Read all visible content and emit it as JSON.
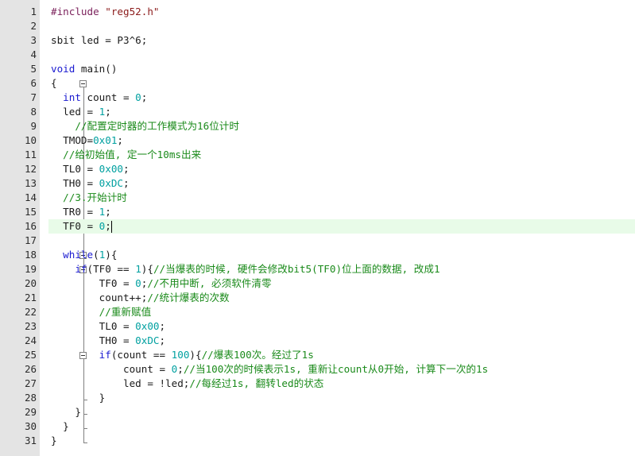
{
  "editor": {
    "line_numbers": [
      "1",
      "2",
      "3",
      "4",
      "5",
      "6",
      "7",
      "8",
      "9",
      "10",
      "11",
      "12",
      "13",
      "14",
      "15",
      "16",
      "17",
      "18",
      "19",
      "20",
      "21",
      "22",
      "23",
      "24",
      "25",
      "26",
      "27",
      "28",
      "29",
      "30",
      "31"
    ],
    "lines": [
      {
        "tokens": [
          {
            "t": "pp",
            "v": "#include "
          },
          {
            "t": "str",
            "v": "\"reg52.h\""
          }
        ]
      },
      {
        "tokens": []
      },
      {
        "tokens": [
          {
            "t": "tx",
            "v": "sbit led = P3^6;"
          }
        ]
      },
      {
        "tokens": []
      },
      {
        "tokens": [
          {
            "t": "kw",
            "v": "void"
          },
          {
            "t": "tx",
            "v": " main()"
          }
        ]
      },
      {
        "tokens": [
          {
            "t": "tx",
            "v": "{"
          }
        ]
      },
      {
        "tokens": [
          {
            "t": "tx",
            "v": "  "
          },
          {
            "t": "kw",
            "v": "int"
          },
          {
            "t": "tx",
            "v": " count = "
          },
          {
            "t": "num",
            "v": "0"
          },
          {
            "t": "tx",
            "v": ";"
          }
        ]
      },
      {
        "tokens": [
          {
            "t": "tx",
            "v": "  led = "
          },
          {
            "t": "num",
            "v": "1"
          },
          {
            "t": "tx",
            "v": ";"
          }
        ]
      },
      {
        "tokens": [
          {
            "t": "tx",
            "v": "    "
          },
          {
            "t": "cm",
            "v": "//配置定时器的工作模式为16位计时"
          }
        ]
      },
      {
        "tokens": [
          {
            "t": "tx",
            "v": "  TMOD="
          },
          {
            "t": "num",
            "v": "0x01"
          },
          {
            "t": "tx",
            "v": ";"
          }
        ]
      },
      {
        "tokens": [
          {
            "t": "tx",
            "v": "  "
          },
          {
            "t": "cm",
            "v": "//给初始值, 定一个10ms出来"
          }
        ]
      },
      {
        "tokens": [
          {
            "t": "tx",
            "v": "  TL0 = "
          },
          {
            "t": "num",
            "v": "0x00"
          },
          {
            "t": "tx",
            "v": ";"
          }
        ]
      },
      {
        "tokens": [
          {
            "t": "tx",
            "v": "  TH0 = "
          },
          {
            "t": "num",
            "v": "0xDC"
          },
          {
            "t": "tx",
            "v": ";"
          }
        ]
      },
      {
        "tokens": [
          {
            "t": "tx",
            "v": "  "
          },
          {
            "t": "cm",
            "v": "//3.开始计时"
          }
        ]
      },
      {
        "tokens": [
          {
            "t": "tx",
            "v": "  TR0 = "
          },
          {
            "t": "num",
            "v": "1"
          },
          {
            "t": "tx",
            "v": ";"
          }
        ]
      },
      {
        "tokens": [
          {
            "t": "tx",
            "v": "  TF0 = "
          },
          {
            "t": "num",
            "v": "0"
          },
          {
            "t": "tx",
            "v": ";"
          }
        ],
        "active": true
      },
      {
        "tokens": []
      },
      {
        "tokens": [
          {
            "t": "tx",
            "v": "  "
          },
          {
            "t": "kw",
            "v": "while"
          },
          {
            "t": "tx",
            "v": "("
          },
          {
            "t": "num",
            "v": "1"
          },
          {
            "t": "tx",
            "v": "){"
          }
        ]
      },
      {
        "tokens": [
          {
            "t": "tx",
            "v": "    "
          },
          {
            "t": "kw",
            "v": "if"
          },
          {
            "t": "tx",
            "v": "(TF0 == "
          },
          {
            "t": "num",
            "v": "1"
          },
          {
            "t": "tx",
            "v": "){"
          },
          {
            "t": "cm",
            "v": "//当爆表的时候, 硬件会修改bit5(TF0)位上面的数据, 改成1"
          }
        ]
      },
      {
        "tokens": [
          {
            "t": "tx",
            "v": "        TF0 = "
          },
          {
            "t": "num",
            "v": "0"
          },
          {
            "t": "tx",
            "v": ";"
          },
          {
            "t": "cm",
            "v": "//不用中断, 必须软件清零"
          }
        ]
      },
      {
        "tokens": [
          {
            "t": "tx",
            "v": "        count++;"
          },
          {
            "t": "cm",
            "v": "//统计爆表的次数"
          }
        ]
      },
      {
        "tokens": [
          {
            "t": "tx",
            "v": "        "
          },
          {
            "t": "cm",
            "v": "//重新赋值"
          }
        ]
      },
      {
        "tokens": [
          {
            "t": "tx",
            "v": "        TL0 = "
          },
          {
            "t": "num",
            "v": "0x00"
          },
          {
            "t": "tx",
            "v": ";"
          }
        ]
      },
      {
        "tokens": [
          {
            "t": "tx",
            "v": "        TH0 = "
          },
          {
            "t": "num",
            "v": "0xDC"
          },
          {
            "t": "tx",
            "v": ";"
          }
        ]
      },
      {
        "tokens": [
          {
            "t": "tx",
            "v": "        "
          },
          {
            "t": "kw",
            "v": "if"
          },
          {
            "t": "tx",
            "v": "(count == "
          },
          {
            "t": "num",
            "v": "100"
          },
          {
            "t": "tx",
            "v": "){"
          },
          {
            "t": "cm",
            "v": "//爆表100次。经过了1s"
          }
        ]
      },
      {
        "tokens": [
          {
            "t": "tx",
            "v": "            count = "
          },
          {
            "t": "num",
            "v": "0"
          },
          {
            "t": "tx",
            "v": ";"
          },
          {
            "t": "cm",
            "v": "//当100次的时候表示1s, 重新让count从0开始, 计算下一次的1s"
          }
        ]
      },
      {
        "tokens": [
          {
            "t": "tx",
            "v": "            led = !led;"
          },
          {
            "t": "cm",
            "v": "//每经过1s, 翻转led的状态"
          }
        ]
      },
      {
        "tokens": [
          {
            "t": "tx",
            "v": "        }"
          }
        ]
      },
      {
        "tokens": [
          {
            "t": "tx",
            "v": "    }"
          }
        ]
      },
      {
        "tokens": [
          {
            "t": "tx",
            "v": "  }"
          }
        ]
      },
      {
        "tokens": [
          {
            "t": "tx",
            "v": "}"
          }
        ]
      }
    ]
  }
}
